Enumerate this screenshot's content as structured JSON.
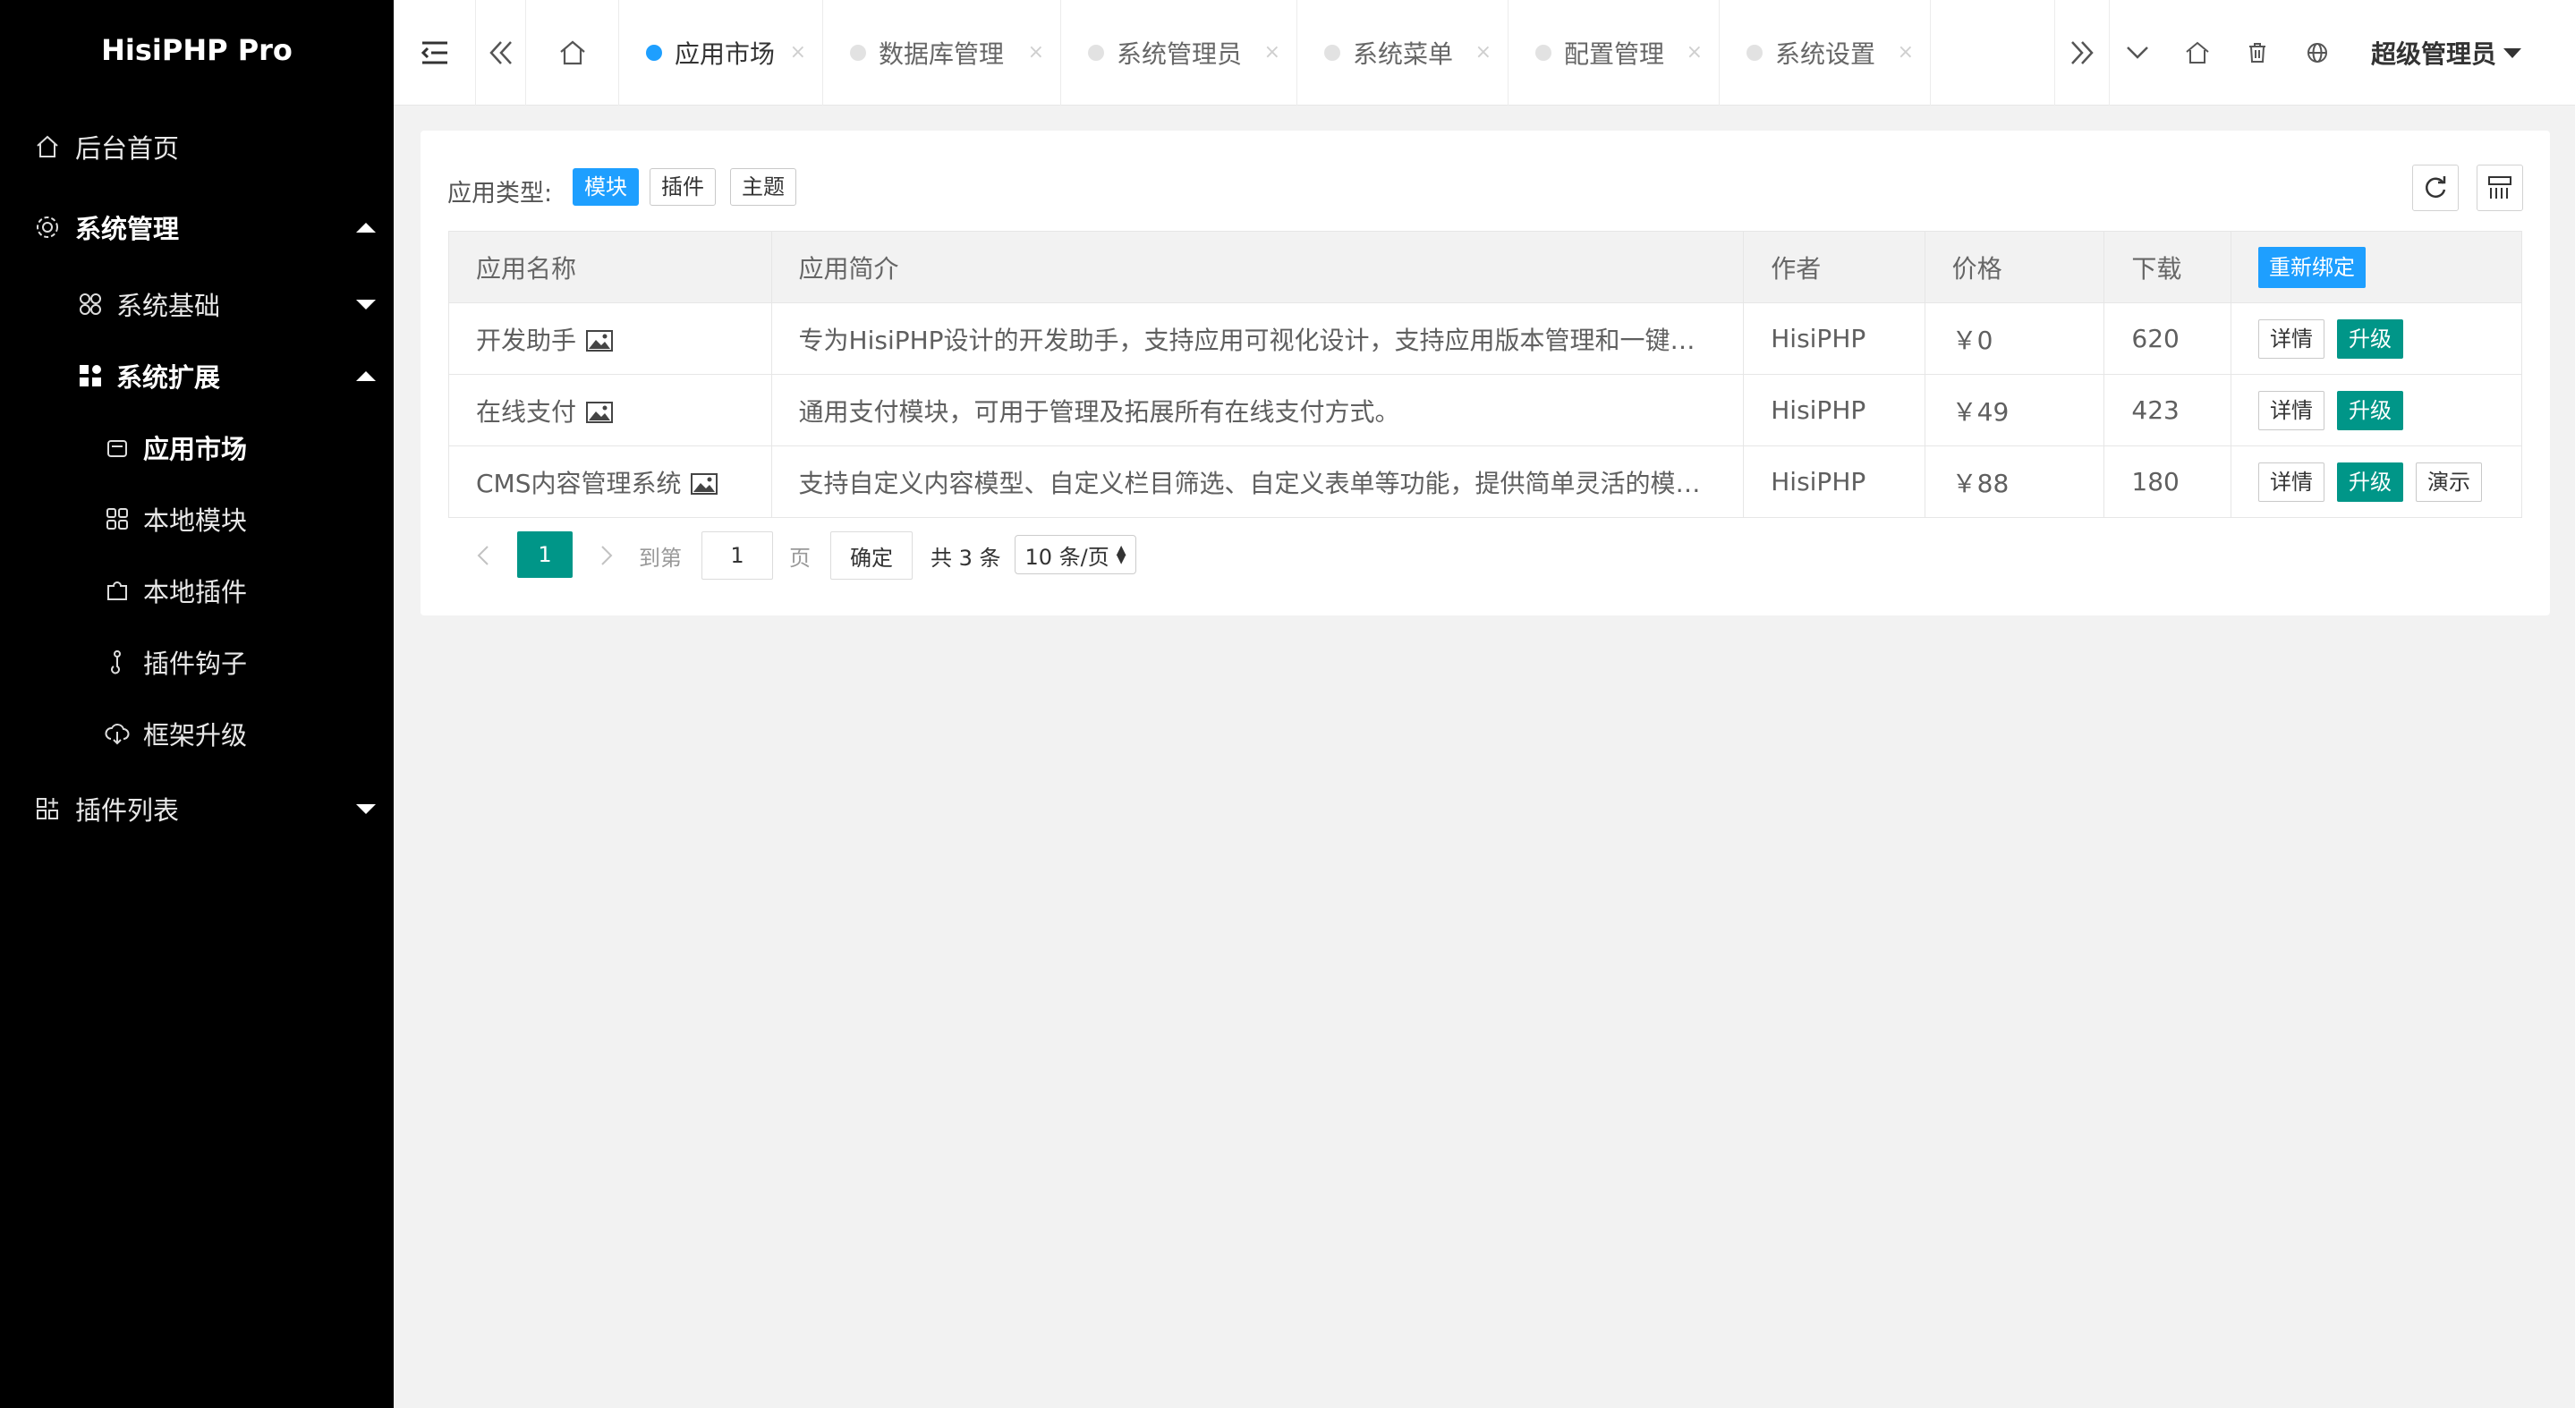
{
  "sidebar": {
    "logo": "HisiPHP Pro",
    "items": [
      {
        "label": "后台首页"
      },
      {
        "label": "系统管理"
      },
      {
        "label": "系统基础"
      },
      {
        "label": "系统扩展"
      },
      {
        "label": "应用市场"
      },
      {
        "label": "本地模块"
      },
      {
        "label": "本地插件"
      },
      {
        "label": "插件钩子"
      },
      {
        "label": "框架升级"
      },
      {
        "label": "插件列表"
      }
    ]
  },
  "header": {
    "tabs": [
      {
        "label": "应用市场",
        "active": true
      },
      {
        "label": "数据库管理",
        "active": false
      },
      {
        "label": "系统管理员",
        "active": false
      },
      {
        "label": "系统菜单",
        "active": false
      },
      {
        "label": "配置管理",
        "active": false
      },
      {
        "label": "系统设置",
        "active": false
      }
    ],
    "close_glyph": "×",
    "user": "超级管理员"
  },
  "filter": {
    "label": "应用类型:",
    "options": [
      "模块",
      "插件",
      "主题"
    ],
    "selected": "模块"
  },
  "table": {
    "columns": [
      "应用名称",
      "应用简介",
      "作者",
      "价格",
      "下载"
    ],
    "rebind_label": "重新绑定",
    "rows": [
      {
        "name": "开发助手",
        "desc": "专为HisiPHP设计的开发助手，支持应用可视化设计，支持应用版本管理和一键…",
        "author": "HisiPHP",
        "price": "￥0",
        "downloads": "620",
        "actions": [
          "详情",
          "升级"
        ]
      },
      {
        "name": "在线支付",
        "desc": "通用支付模块，可用于管理及拓展所有在线支付方式。",
        "author": "HisiPHP",
        "price": "￥49",
        "downloads": "423",
        "actions": [
          "详情",
          "升级"
        ]
      },
      {
        "name": "CMS内容管理系统",
        "desc": "支持自定义内容模型、自定义栏目筛选、自定义表单等功能，提供简单灵活的模…",
        "author": "HisiPHP",
        "price": "￥88",
        "downloads": "180",
        "actions": [
          "详情",
          "升级",
          "演示"
        ]
      }
    ]
  },
  "pager": {
    "current": "1",
    "goto_label": "到第",
    "goto_value": "1",
    "page_unit": "页",
    "confirm": "确定",
    "total": "共 3 条",
    "per_page": "10 条/页"
  }
}
